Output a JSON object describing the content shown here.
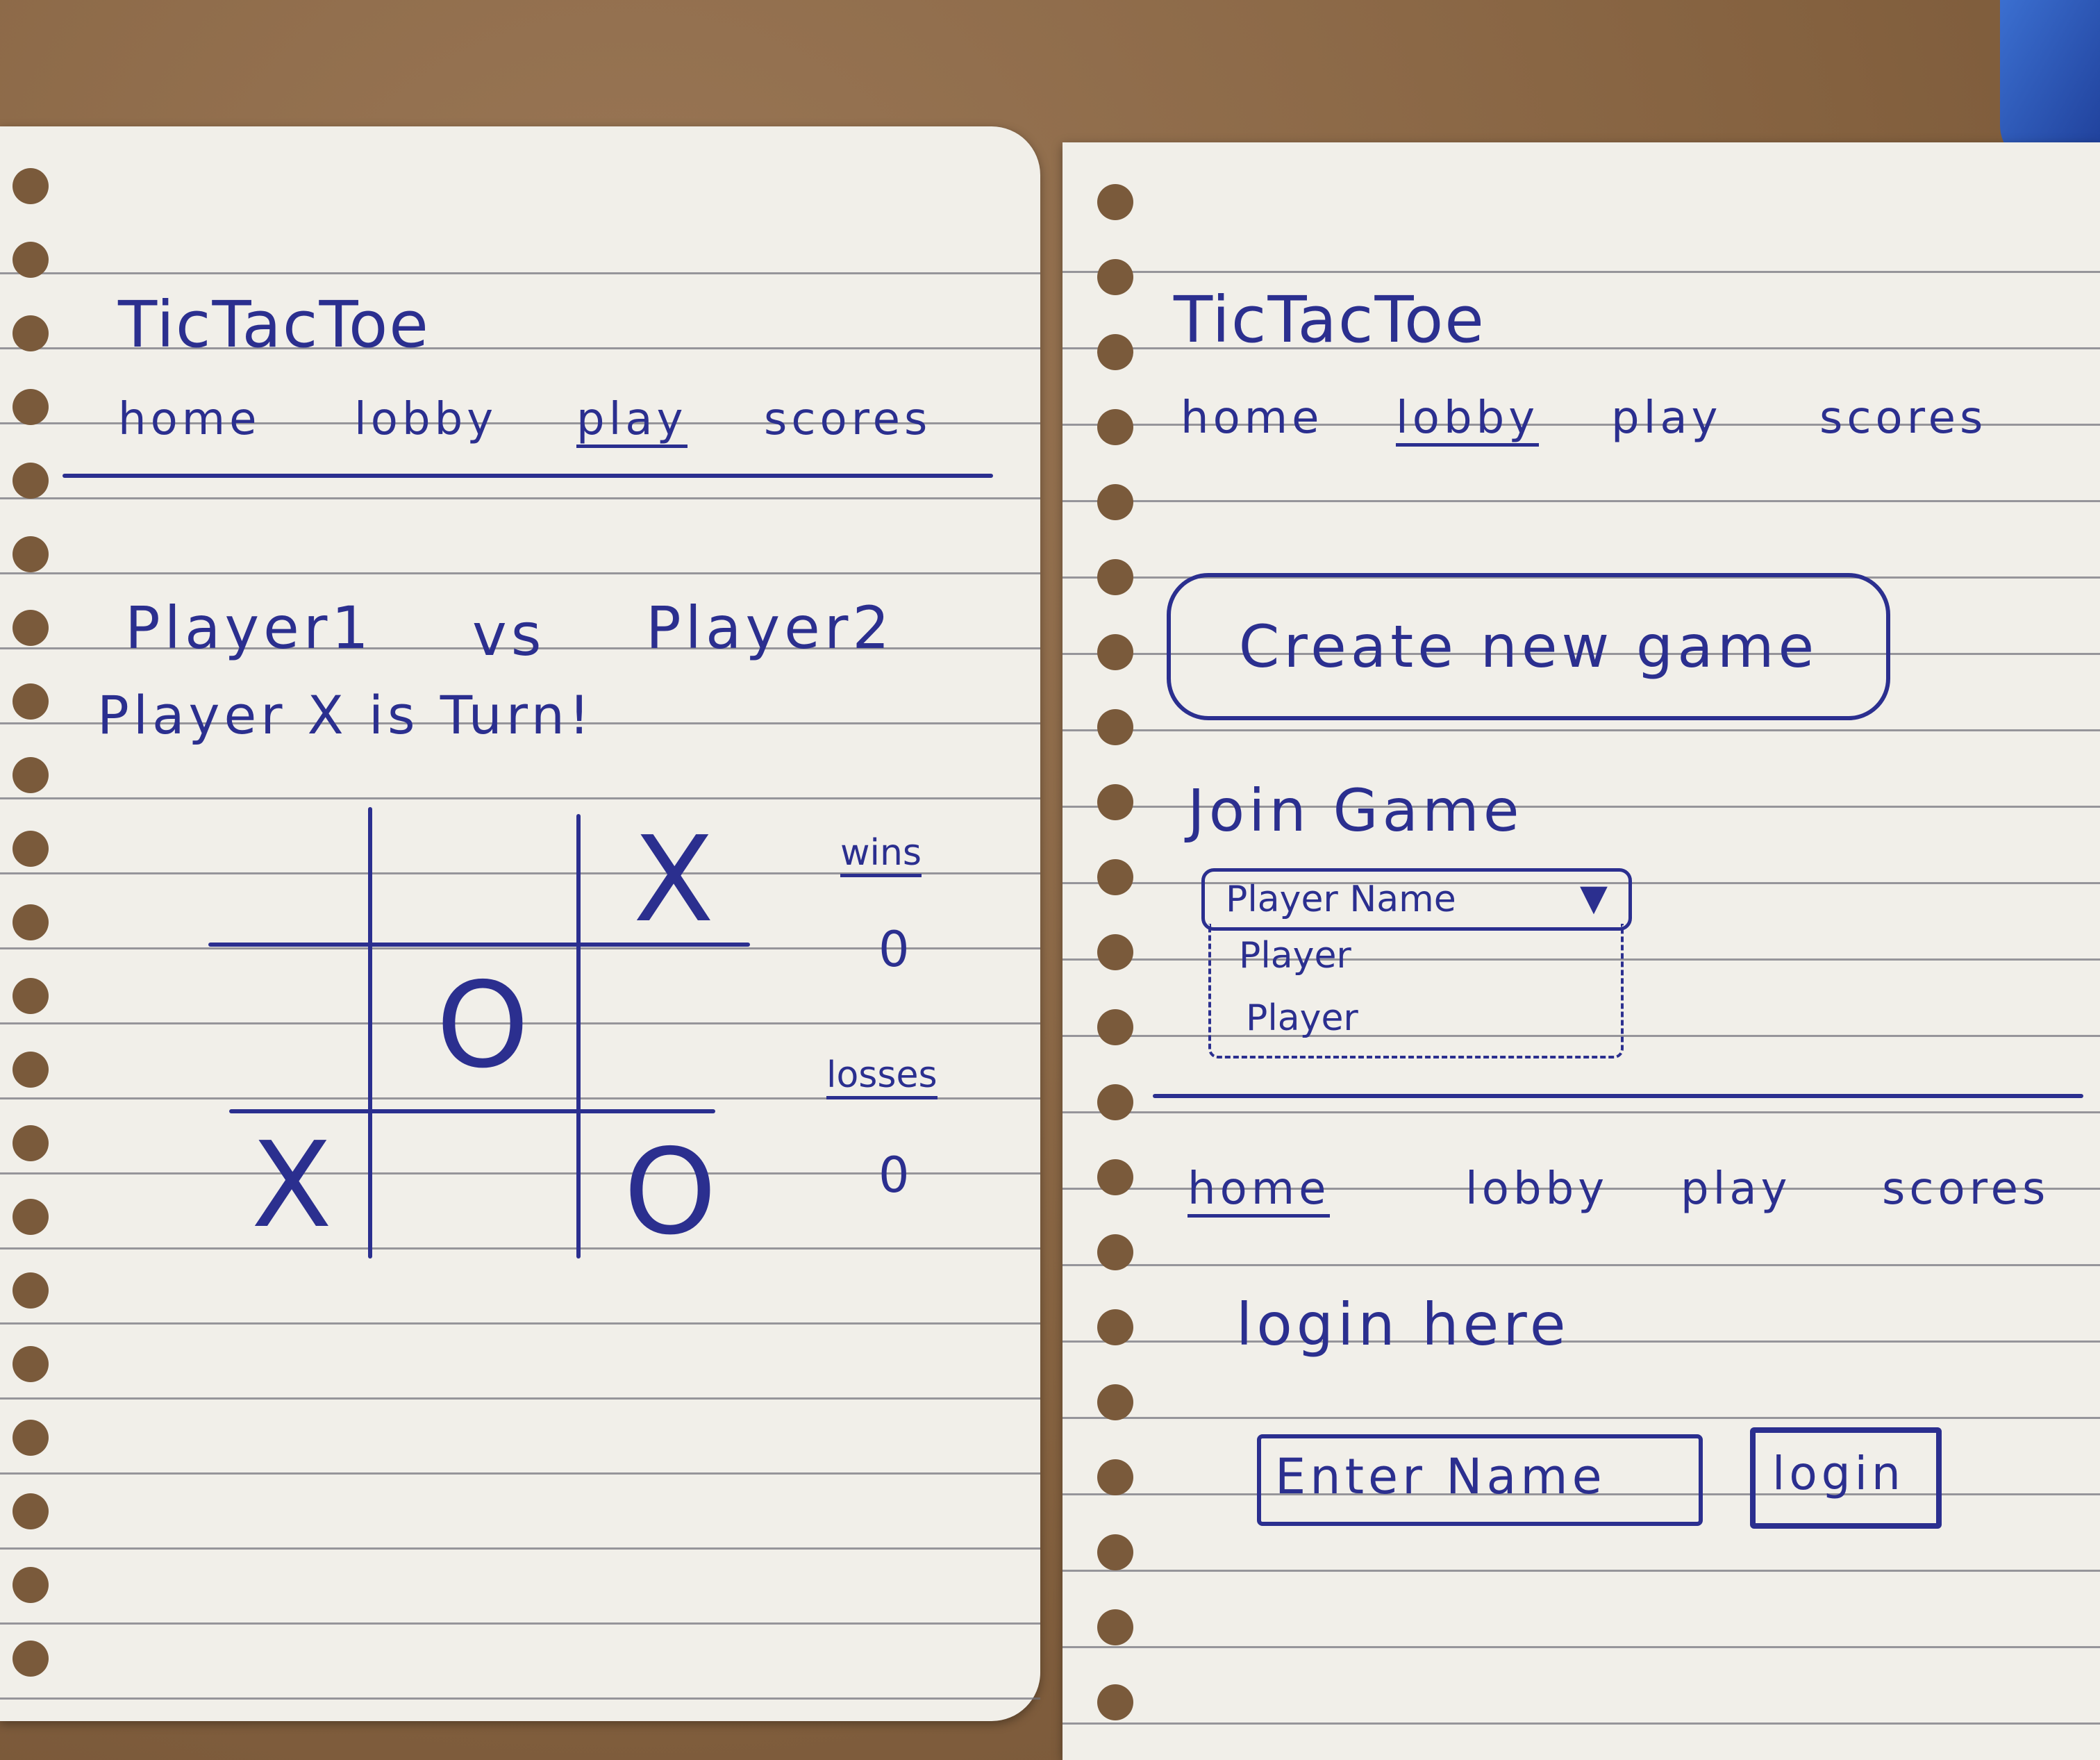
{
  "left_sketch": {
    "title": "TicTacToe",
    "nav": [
      "home",
      "lobby",
      "play",
      "scores"
    ],
    "matchup": {
      "player1": "Player1",
      "vs": "vs",
      "player2": "Player2"
    },
    "turn_text": "Player X is Turn!",
    "board": [
      "",
      "",
      "X",
      "",
      "O",
      "",
      "X",
      "",
      "O"
    ],
    "wins": {
      "label": "wins",
      "value": "0"
    },
    "losses": {
      "label": "losses",
      "value": "0"
    }
  },
  "right_sketch": {
    "title": "TicTacToe",
    "nav_top": [
      "home",
      "lobby",
      "play",
      "scores"
    ],
    "create_button": "Create new game",
    "join_heading": "Join Game",
    "select": {
      "value": "Player Name",
      "options": [
        "Player",
        "Player"
      ]
    },
    "nav_bottom": [
      "home",
      "lobby",
      "play",
      "scores"
    ],
    "login_heading": "login here",
    "name_input_placeholder": "Enter Name",
    "login_button": "login"
  },
  "colors": {
    "ink": "#2b2f8f",
    "paper": "#f1efe9",
    "desk": "#8c6a4a"
  }
}
